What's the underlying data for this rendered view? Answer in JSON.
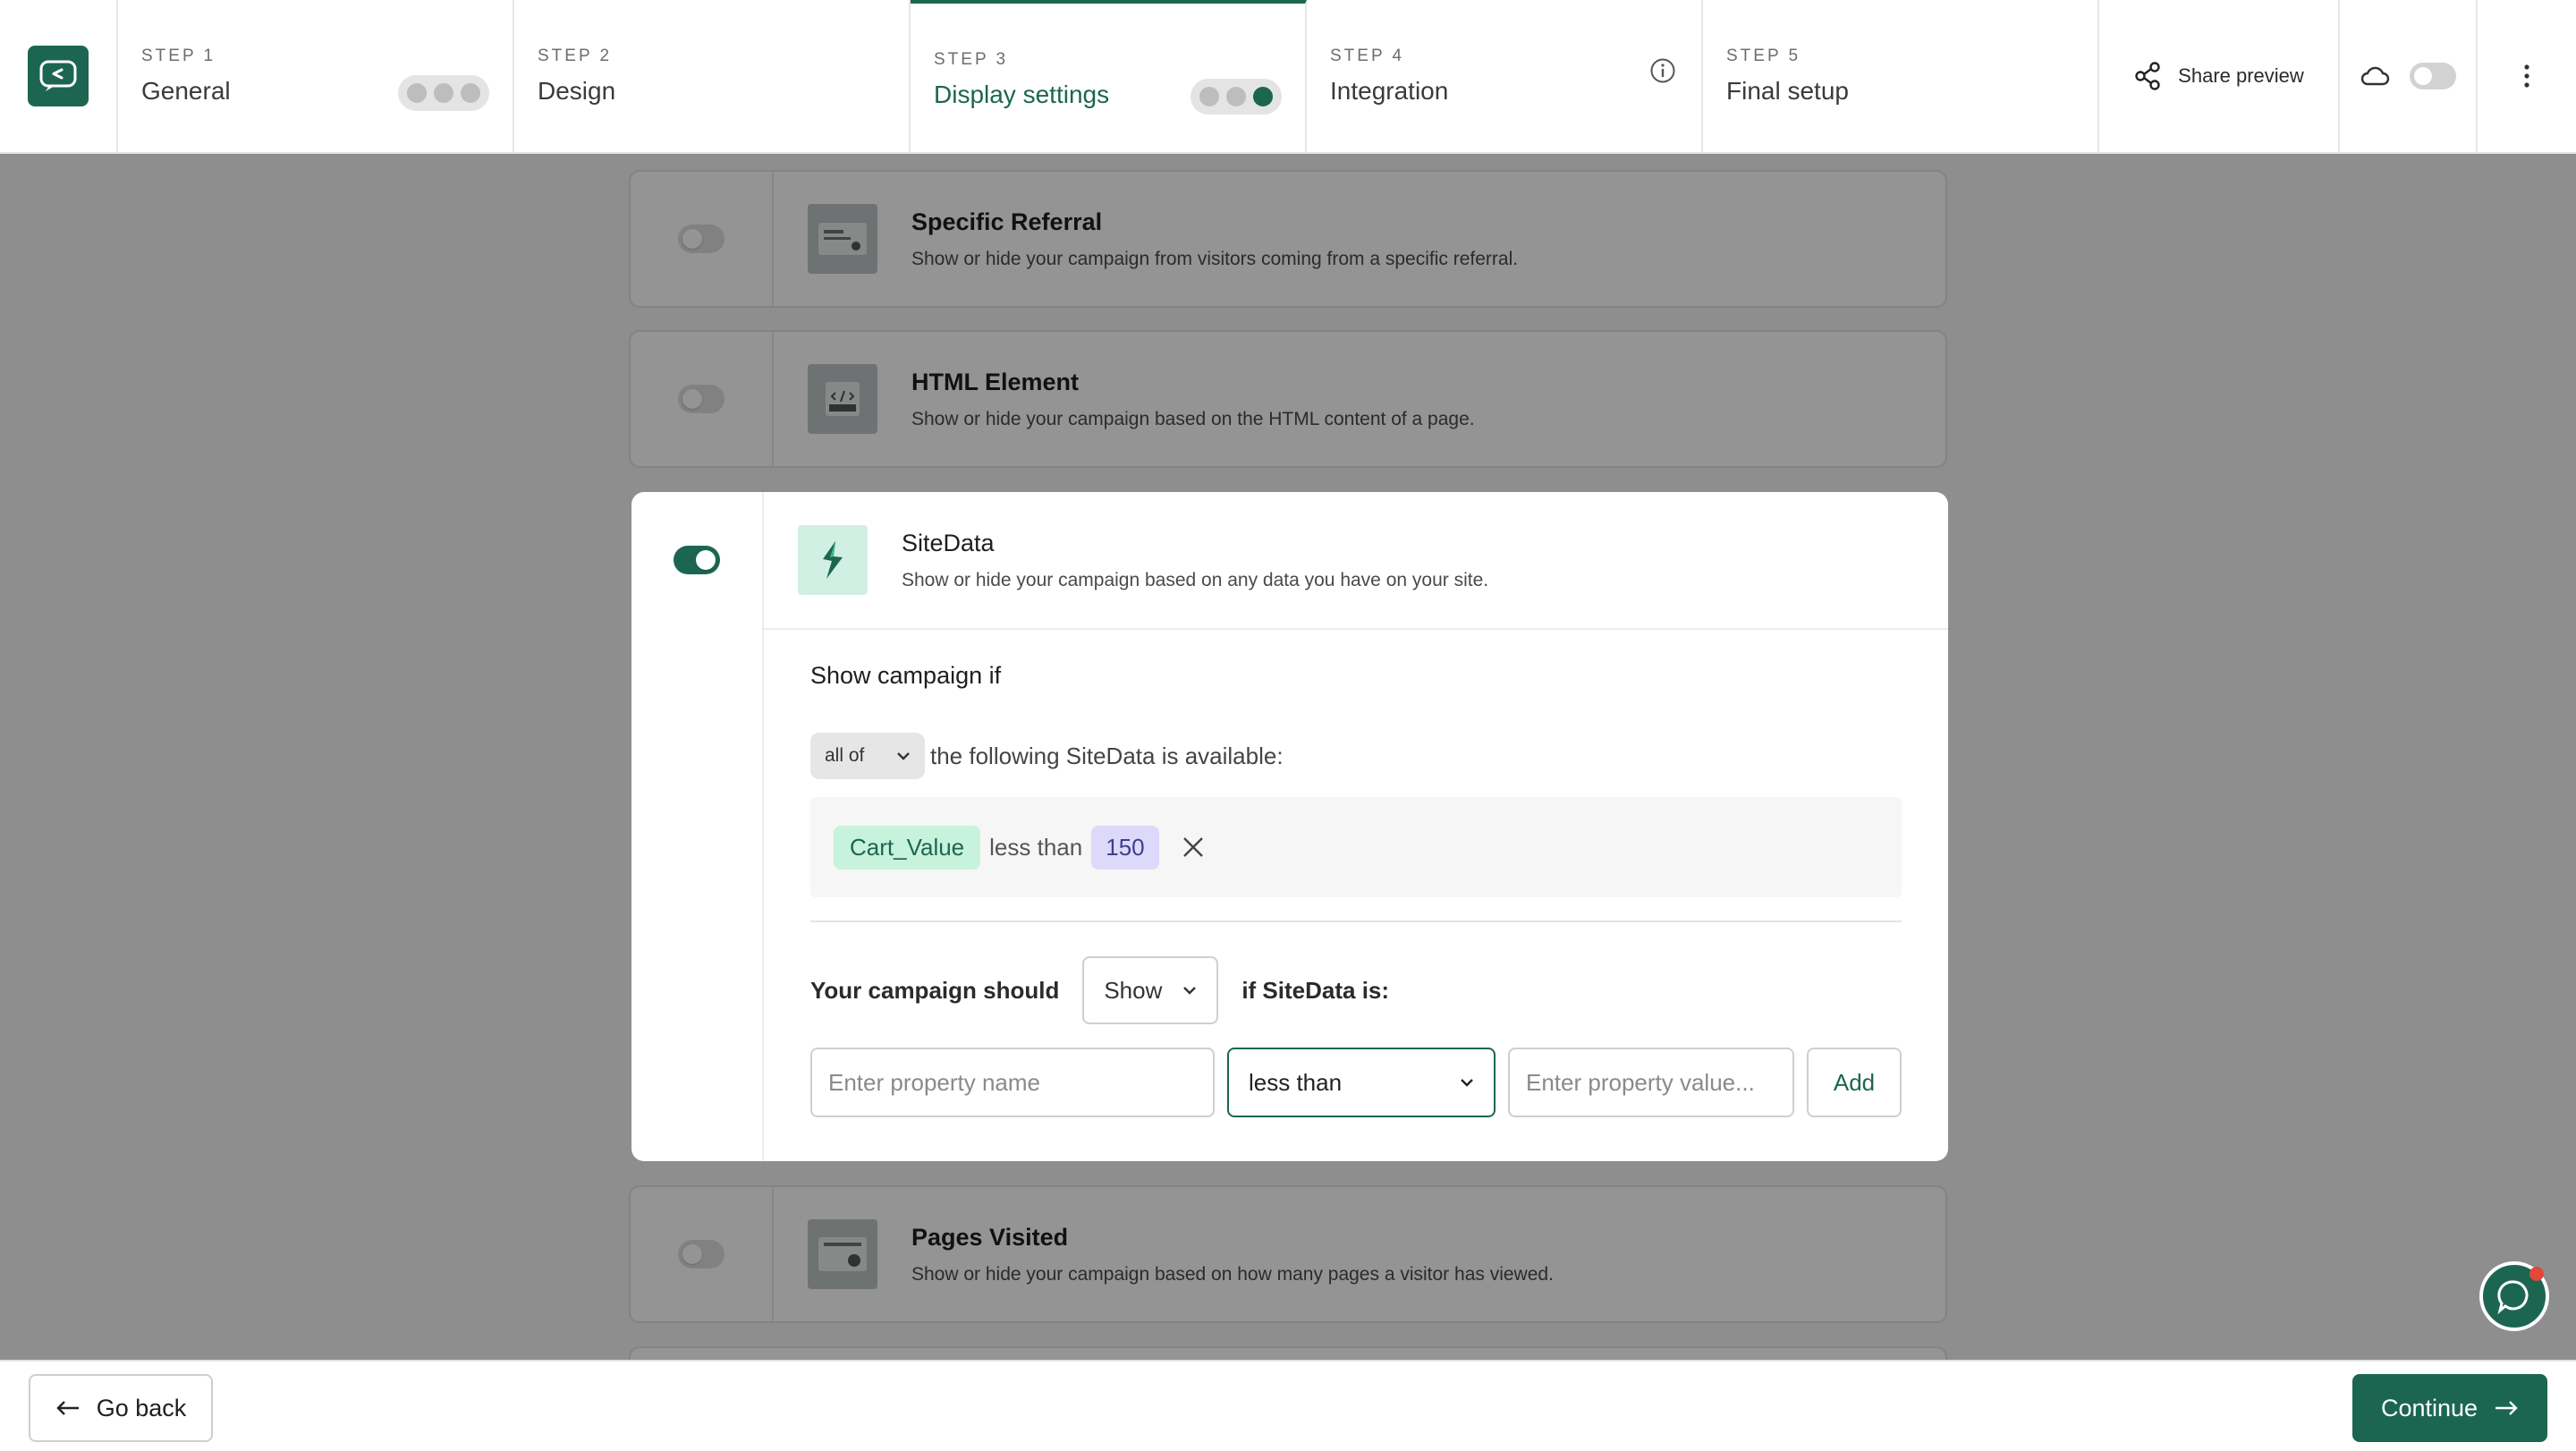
{
  "header": {
    "steps": [
      {
        "num": "STEP 1",
        "title": "General"
      },
      {
        "num": "STEP 2",
        "title": "Design"
      },
      {
        "num": "STEP 3",
        "title": "Display settings"
      },
      {
        "num": "STEP 4",
        "title": "Integration"
      },
      {
        "num": "STEP 5",
        "title": "Final setup"
      }
    ],
    "share_label": "Share preview"
  },
  "cards": {
    "referral": {
      "title": "Specific Referral",
      "desc": "Show or hide your campaign from visitors coming from a specific referral."
    },
    "html": {
      "title": "HTML Element",
      "desc": "Show or hide your campaign based on the HTML content of a page."
    },
    "pages": {
      "title": "Pages Visited",
      "desc": "Show or hide your campaign based on how many pages a visitor has viewed."
    }
  },
  "sitedata": {
    "title": "SiteData",
    "desc": "Show or hide your campaign based on any data you have on your site.",
    "show_if": "Show campaign if",
    "match_select": "all of",
    "match_text": "the following SiteData is available:",
    "condition": {
      "property": "Cart_Value",
      "operator": "less than",
      "value": "150"
    },
    "should_label": "Your campaign should",
    "should_select": "Show",
    "should_after": "if SiteData is:",
    "form": {
      "name_placeholder": "Enter property name",
      "operator": "less than",
      "value_placeholder": "Enter property value...",
      "add_label": "Add"
    }
  },
  "footer": {
    "back_label": "Go back",
    "continue_label": "Continue"
  },
  "colors": {
    "brand": "#1c6651",
    "chip_green": "#c7f2db",
    "chip_purple": "#ddd9fb",
    "notification": "#e3473a"
  },
  "icons": [
    "logo-icon",
    "info-icon",
    "share-icon",
    "cloud-icon",
    "more-vertical-icon",
    "chevron-down-icon",
    "close-icon",
    "arrow-left-icon",
    "arrow-right-icon",
    "chat-icon"
  ]
}
